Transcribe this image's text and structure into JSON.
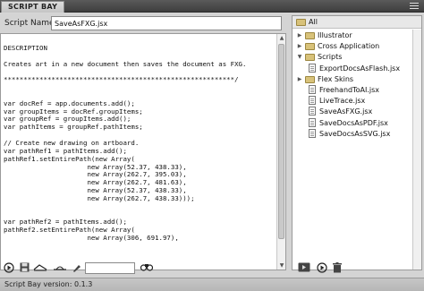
{
  "panel": {
    "tab_label": "SCRIPT BAY"
  },
  "script_name": {
    "label": "Script Name:",
    "value": "SaveAsFXG.jsx"
  },
  "code_lines": [
    "",
    "DESCRIPTION",
    "",
    "Creates art in a new document then saves the document as FXG.",
    "",
    "**********************************************************/",
    "",
    "",
    "var docRef = app.documents.add();",
    "var groupItems = docRef.groupItems;",
    "var groupRef = groupItems.add();",
    "var pathItems = groupRef.pathItems;",
    "",
    "// Create new drawing on artboard.",
    "var pathRef1 = pathItems.add();",
    "pathRef1.setEntirePath(new Array(",
    "                     new Array(52.37, 438.33),",
    "                     new Array(262.7, 395.03),",
    "                     new Array(262.7, 481.63),",
    "                     new Array(52.37, 438.33),",
    "                     new Array(262.7, 438.33)));",
    "",
    "",
    "var pathRef2 = pathItems.add();",
    "pathRef2.setEntirePath(new Array(",
    "                     new Array(306, 691.97),",
    ""
  ],
  "tree": {
    "root_label": "All",
    "items": [
      {
        "label": "Illustrator",
        "type": "folder",
        "expanded": false
      },
      {
        "label": "Cross Application",
        "type": "folder",
        "expanded": false
      },
      {
        "label": "Scripts",
        "type": "folder",
        "expanded": true
      },
      {
        "label": "ExportDocsAsFlash.jsx",
        "type": "file"
      },
      {
        "label": "Flex Skins",
        "type": "folder",
        "expanded": false
      },
      {
        "label": "FreehandToAI.jsx",
        "type": "file"
      },
      {
        "label": "LiveTrace.jsx",
        "type": "file"
      },
      {
        "label": "SaveAsFXG.jsx",
        "type": "file"
      },
      {
        "label": "SaveDocsAsPDF.jsx",
        "type": "file"
      },
      {
        "label": "SaveDocsAsSVG.jsx",
        "type": "file"
      }
    ]
  },
  "toolbar_left": {
    "icons": [
      "run-icon",
      "save-icon",
      "new-script-icon",
      "new-line-icon",
      "brush-icon"
    ],
    "find_value": "",
    "search_icon": "binoculars-icon"
  },
  "toolbar_right": {
    "icons": [
      "run-target-icon",
      "play-icon",
      "delete-icon"
    ]
  },
  "status": {
    "text": "Script Bay version: 0.1.3"
  }
}
